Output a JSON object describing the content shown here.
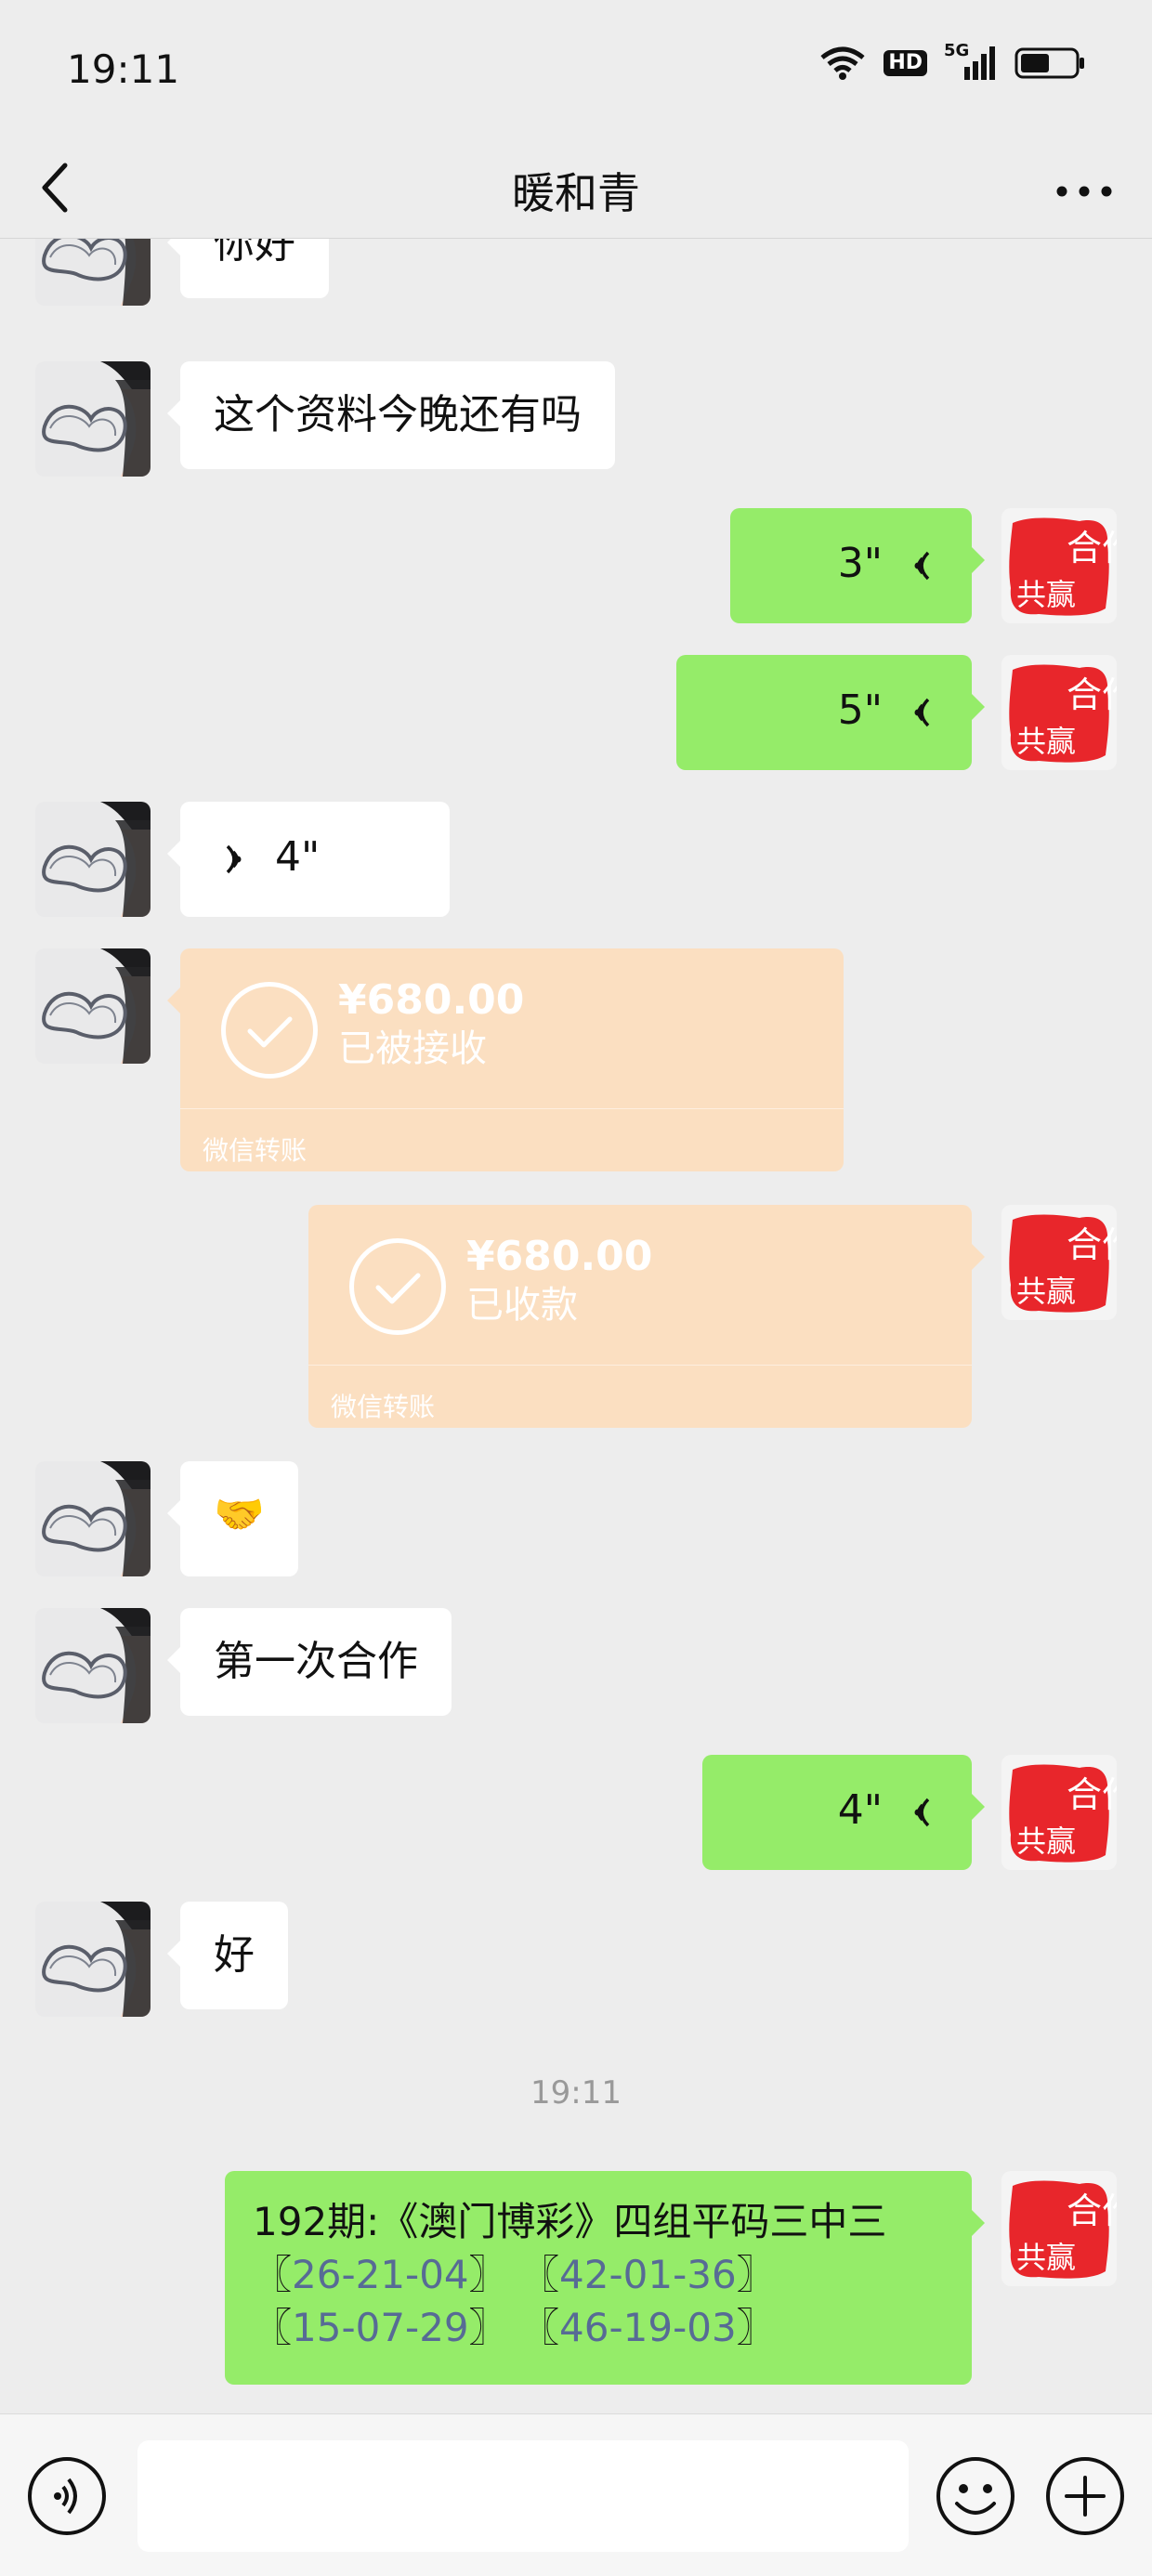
{
  "status_bar": {
    "time": "19:11",
    "hd": "HD",
    "network": "5G"
  },
  "nav": {
    "title": "暖和青"
  },
  "messages": {
    "m1": "你好",
    "m2": "这个资料今晚还有吗",
    "m3": "3\"",
    "m4": "5\"",
    "m5": "4\"",
    "m6": {
      "amount": "¥680.00",
      "status": "已被接收",
      "footer": "微信转账"
    },
    "m7": {
      "amount": "¥680.00",
      "status": "已收款",
      "footer": "微信转账"
    },
    "m8": "🤝",
    "m9": "第一次合作",
    "m10": "4\"",
    "m11": "好",
    "timestamp": "19:11",
    "m12": {
      "line1": "192期:《澳门博彩》四组平码三中三",
      "codes": [
        {
          "open": "〖",
          "value": "26-21-04",
          "close": "〗"
        },
        {
          "open": "〖",
          "value": "42-01-36",
          "close": "〗"
        },
        {
          "open": "〖",
          "value": "15-07-29",
          "close": "〗"
        },
        {
          "open": "〖",
          "value": "46-19-03",
          "close": "〗"
        }
      ]
    }
  },
  "self_avatar_text": {
    "top": "合作",
    "bottom": "共赢"
  },
  "colors": {
    "green_bubble": "#95ec69",
    "transfer_bubble": "#fbdfc1",
    "link_blue": "#576b95",
    "seal_red": "#e8262b"
  },
  "icons": [
    "back-icon",
    "more-icon",
    "wifi-icon",
    "signal-icon",
    "battery-icon",
    "voice-icon",
    "emoji-icon",
    "plus-icon",
    "check-icon"
  ]
}
